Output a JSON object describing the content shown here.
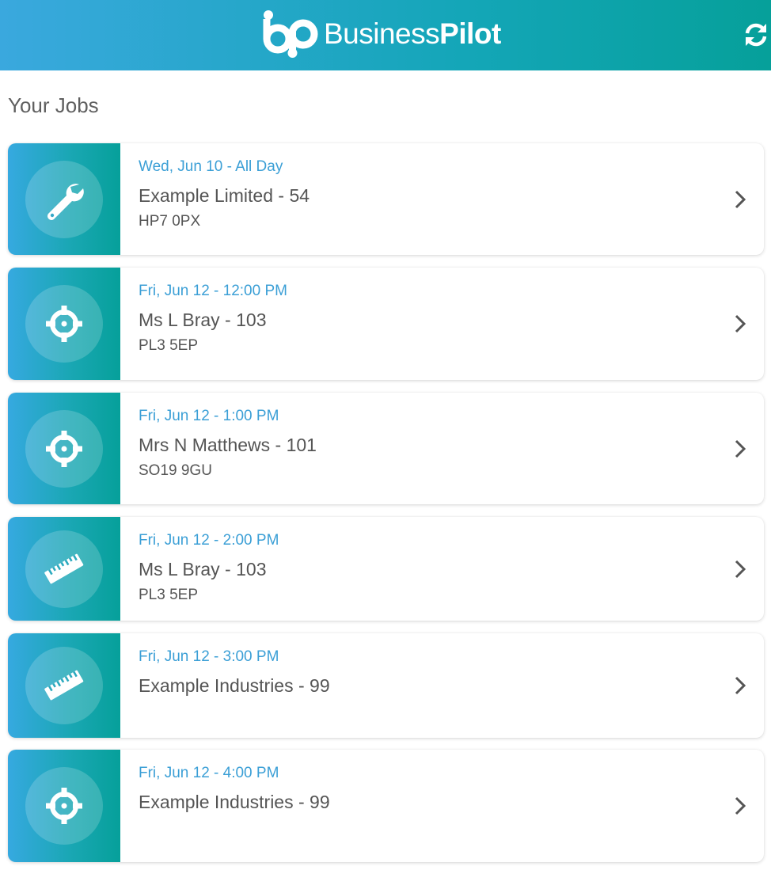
{
  "header": {
    "logo_text_regular": "Business",
    "logo_text_bold": "Pilot",
    "refresh_icon": "refresh-icon",
    "colors": {
      "gradient_start": "#3aa8de",
      "gradient_end": "#06a09a"
    }
  },
  "page": {
    "title": "Your Jobs"
  },
  "jobs": [
    {
      "date": "Wed, Jun 10 - All Day",
      "name": "Example Limited - 54",
      "postcode": "HP7 0PX",
      "icon": "wrench-icon"
    },
    {
      "date": "Fri, Jun 12 - 12:00 PM",
      "name": "Ms L Bray - 103",
      "postcode": "PL3 5EP",
      "icon": "crosshair-icon"
    },
    {
      "date": "Fri, Jun 12 - 1:00 PM",
      "name": "Mrs N Matthews - 101",
      "postcode": "SO19 9GU",
      "icon": "crosshair-icon"
    },
    {
      "date": "Fri, Jun 12 - 2:00 PM",
      "name": "Ms L Bray - 103",
      "postcode": "PL3 5EP",
      "icon": "ruler-icon"
    },
    {
      "date": "Fri, Jun 12 - 3:00 PM",
      "name": "Example Industries - 99",
      "postcode": "",
      "icon": "ruler-icon"
    },
    {
      "date": "Fri, Jun 12 - 4:00 PM",
      "name": "Example Industries - 99",
      "postcode": "",
      "icon": "crosshair-icon"
    }
  ],
  "colors": {
    "accent_date": "#3b9fd6",
    "text": "#555555",
    "title": "#5f5f5f"
  }
}
